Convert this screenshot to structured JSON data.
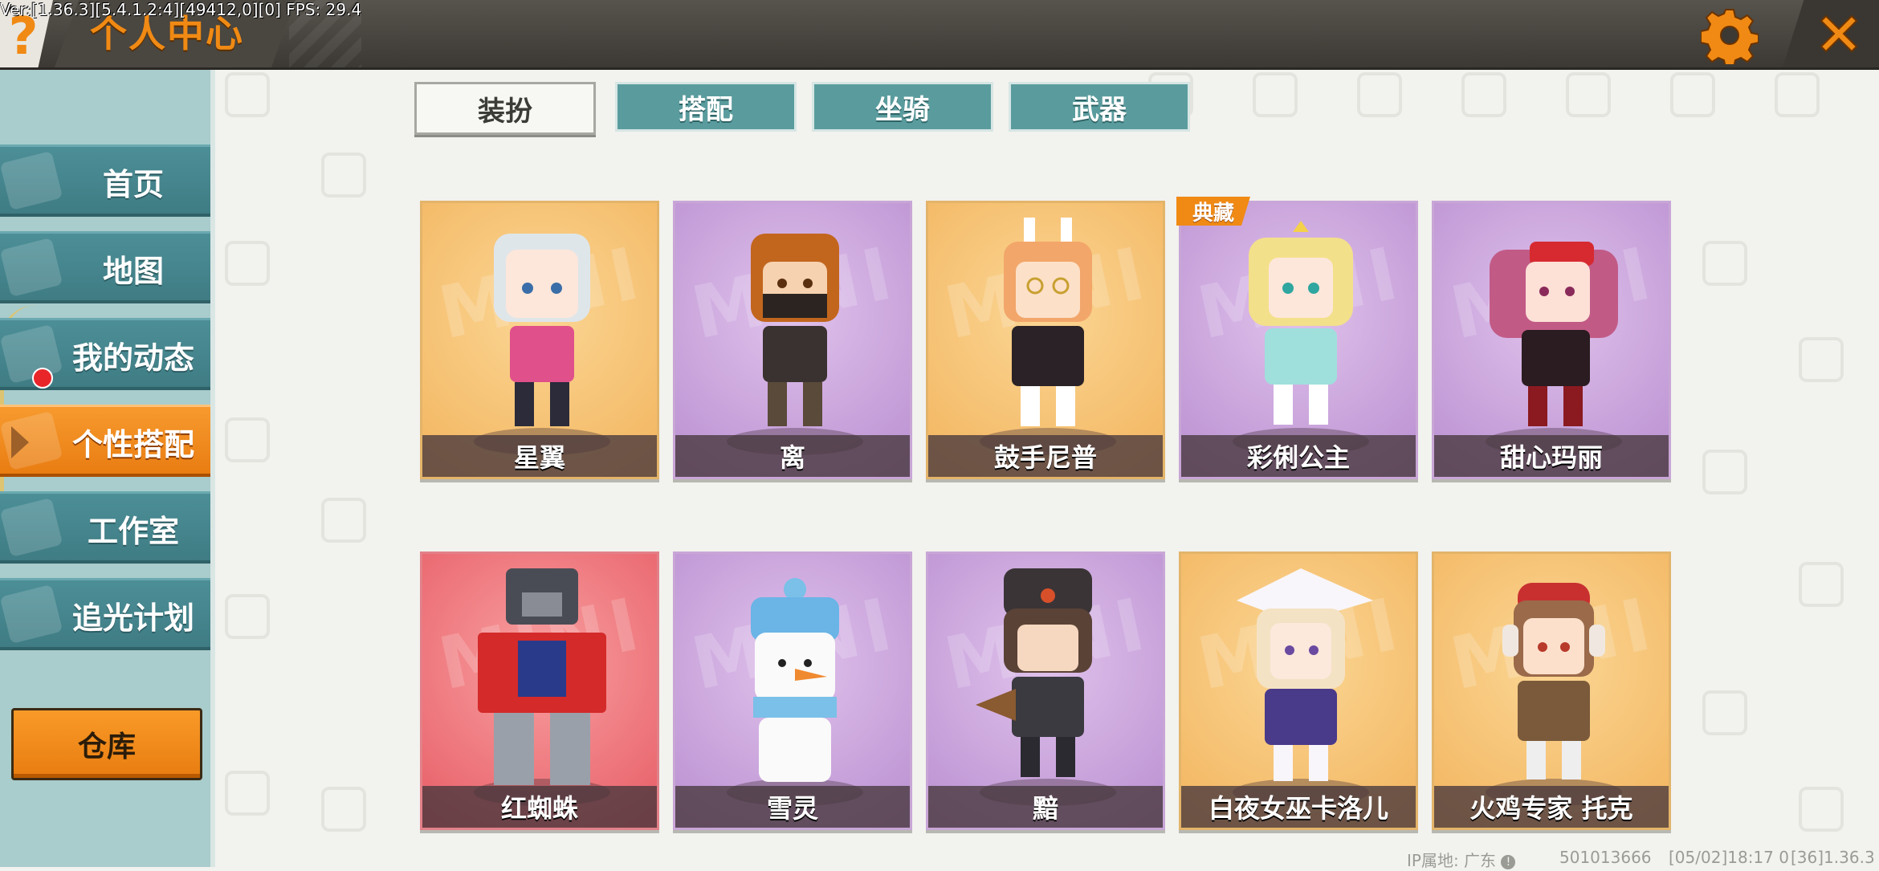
{
  "debug": "Ver:[1.36.3][5.4.1.2:4][49412,0][0] FPS: 29.4",
  "header": {
    "help_glyph": "?",
    "title": "个人中心",
    "settings_icon": "gear-icon",
    "close_icon": "close-icon",
    "accent_color": "#f08a14"
  },
  "sidebar": {
    "items": [
      {
        "label": "首页"
      },
      {
        "label": "地图"
      },
      {
        "label": "我的动态"
      },
      {
        "label": "个性搭配"
      },
      {
        "label": "工作室"
      },
      {
        "label": "追光计划"
      }
    ],
    "active_item": "个性搭配",
    "warehouse_label": "仓库"
  },
  "tabs": [
    {
      "label": "装扮"
    },
    {
      "label": "搭配"
    },
    {
      "label": "坐骑"
    },
    {
      "label": "武器"
    }
  ],
  "active_tab": "装扮",
  "badge": "典藏",
  "cards": [
    {
      "name": "星翼",
      "bg": "orange"
    },
    {
      "name": "离",
      "bg": "purple"
    },
    {
      "name": "鼓手尼普",
      "bg": "orange"
    },
    {
      "name": "彩俐公主",
      "bg": "purple"
    },
    {
      "name": "甜心玛丽",
      "bg": "purple"
    },
    {
      "name": "红蜘蛛",
      "bg": "red"
    },
    {
      "name": "雪灵",
      "bg": "purple"
    },
    {
      "name": "黯",
      "bg": "purple"
    },
    {
      "name": "白夜女巫卡洛儿",
      "bg": "orange"
    },
    {
      "name": "火鸡专家 托克",
      "bg": "orange"
    }
  ],
  "footer": {
    "ip_location": "IP属地: 广东",
    "info_icon": "info-icon",
    "uid": "501013666",
    "timestamp": "[05/02]18:17 0",
    "version": "[36]1.36.3"
  }
}
